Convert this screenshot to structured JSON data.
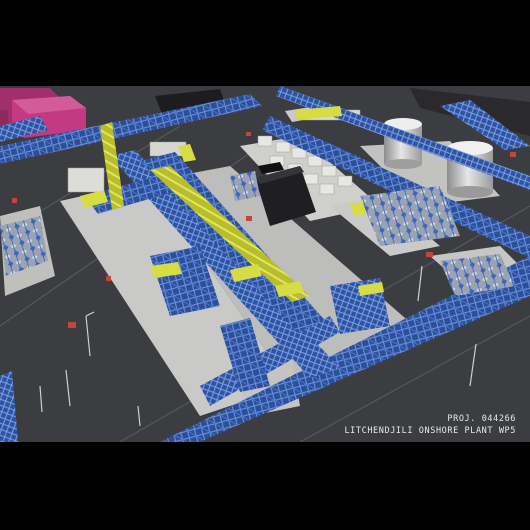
{
  "caption": {
    "project_number": "PROJ. 044266",
    "plant_name": "LITCHENDJILI ONSHORE PLANT WP5"
  },
  "colors": {
    "ground": "#3b3d40",
    "pad": "#c9c9c7",
    "steel_blue": "#3e66b8",
    "pipe_yellow": "#c9cf3a",
    "building_magenta": "#b0306f",
    "tank": "#c8c8c8",
    "equipment_red": "#c0463f",
    "dark_block": "#1d1d1f"
  }
}
